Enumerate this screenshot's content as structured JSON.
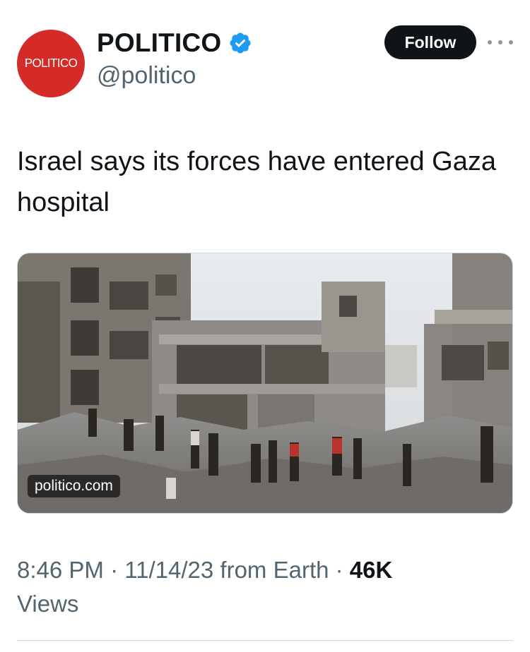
{
  "author": {
    "avatar_text": "POLITICO",
    "display_name": "POLITICO",
    "handle": "@politico",
    "verified": true,
    "brand_color": "#d52b28",
    "verified_color": "#1d9bf0"
  },
  "actions": {
    "follow_label": "Follow",
    "more_icon": "more-horizontal-icon"
  },
  "tweet": {
    "text": "Israel says its forces have entered Gaza hospital"
  },
  "media": {
    "link_label": "politico.com"
  },
  "meta": {
    "time": "8:46 PM",
    "separator": " · ",
    "date": "11/14/23",
    "source": " from Earth",
    "views_count": "46K",
    "views_label": "Views"
  }
}
